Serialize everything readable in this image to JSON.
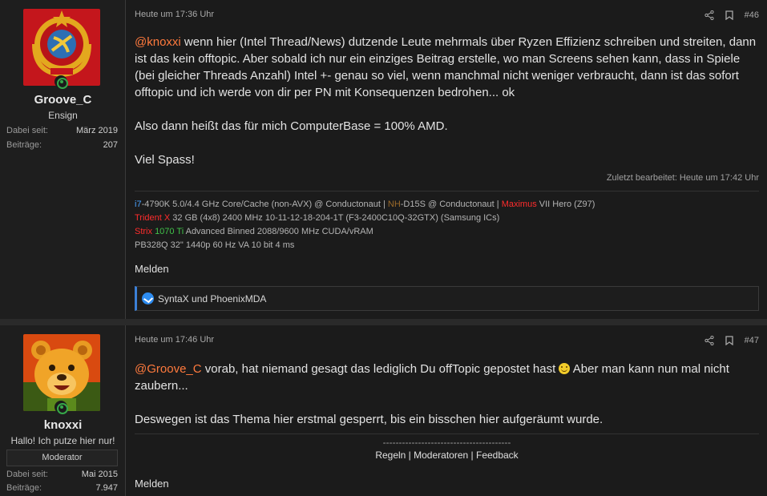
{
  "post46": {
    "author": {
      "name": "Groove_C",
      "title": "Ensign",
      "joined_label": "Dabei seit:",
      "joined_value": "März 2019",
      "posts_label": "Beiträge:",
      "posts_value": "207"
    },
    "timestamp": "Heute um 17:36 Uhr",
    "number": "#46",
    "mention": "@knoxxi",
    "paragraph1": " wenn hier (Intel Thread/News) dutzende Leute mehrmals über Ryzen Effizienz schreiben und streiten, dann ist das kein offtopic. Aber sobald ich nur ein einziges Beitrag erstelle, wo man Screens sehen kann, dass in Spiele (bei gleicher Threads Anzahl) Intel +- genau so viel, wenn manchmal nicht weniger verbraucht, dann ist das sofort offtopic und ich werde von dir per PN mit Konsequenzen bedrohen... ok",
    "paragraph2": "Also dann heißt das für mich ComputerBase = 100% AMD.",
    "paragraph3": "Viel Spass!",
    "edited": "Zuletzt bearbeitet: Heute um 17:42 Uhr",
    "signature": {
      "l1_a": "i7",
      "l1_b": "-4790K 5.0/4.4 GHz Core/Cache (non-AVX) @ Conductonaut | ",
      "l1_c": "NH",
      "l1_d": "-D15S @ Conductonaut | ",
      "l1_e": "Maximus",
      "l1_f": " VII Hero (Z97)",
      "l2_a": "Trident X",
      "l2_b": " 32 GB (4x8) 2400 MHz 10-11-12-18-204-1T (F3-2400C10Q-32GTX) (Samsung ICs)",
      "l3_a": "Strix",
      "l3_b": "1070 Ti",
      "l3_c": " Advanced Binned 2088/9600 MHz CUDA/vRAM",
      "l4": "PB328Q 32\" 1440p 60 Hz VA 10 bit 4 ms"
    },
    "report_label": "Melden",
    "reactions": "SyntaX und PhoenixMDA"
  },
  "post47": {
    "author": {
      "name": "knoxxi",
      "title": "Hallo! Ich putze hier nur!",
      "badge": "Moderator",
      "joined_label": "Dabei seit:",
      "joined_value": "Mai 2015",
      "posts_label": "Beiträge:",
      "posts_value": "7.947"
    },
    "timestamp": "Heute um 17:46 Uhr",
    "number": "#47",
    "mention": "@Groove_C",
    "paragraph1a": " vorab, hat niemand gesagt das lediglich Du offTopic gepostet hast ",
    "paragraph1b": " Aber man kann nun mal nicht zaubern...",
    "paragraph2": "Deswegen ist das Thema hier erstmal gesperrt, bis ein bisschen hier aufgeräumt wurde.",
    "sig_dashes": "----------------------------------------",
    "sig_link1": "Regeln",
    "sig_link2": "Moderatoren",
    "sig_link3": "Feedback",
    "report_label": "Melden"
  }
}
